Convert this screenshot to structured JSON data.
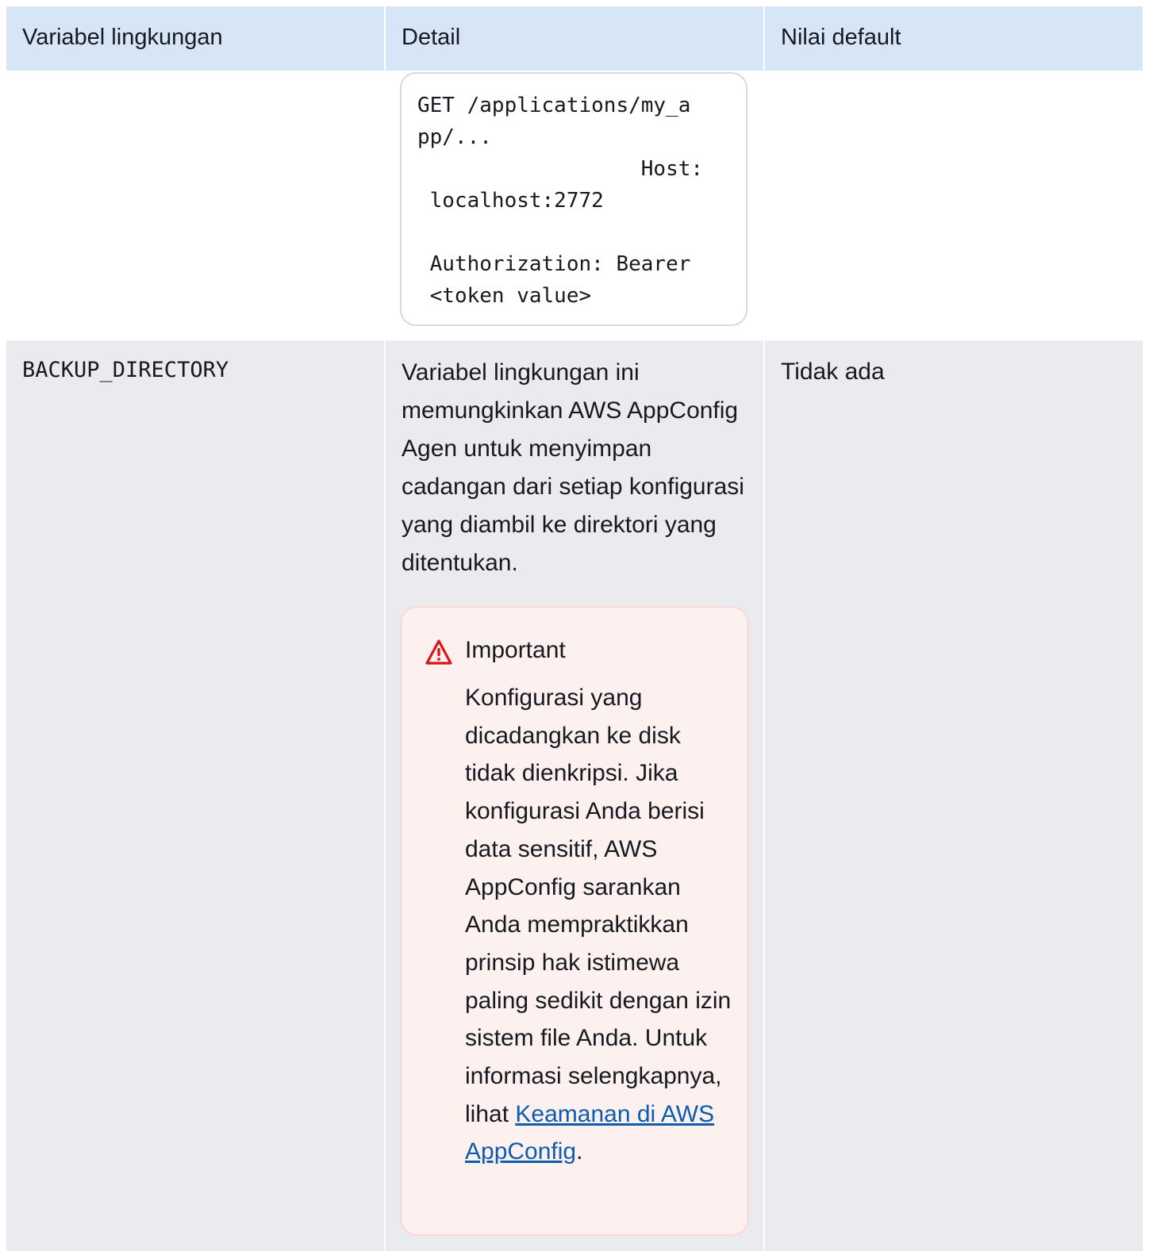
{
  "table": {
    "headers": {
      "variable": "Variabel lingkungan",
      "detail": "Detail",
      "default": "Nilai default"
    },
    "row1": {
      "code": "GET /applications/my_a\npp/...\n                  Host:\n localhost:2772\n\n Authorization: Bearer\n <token value>"
    },
    "row2": {
      "variable": "BACKUP_DIRECTORY",
      "description": "Variabel lingkungan ini memungkinkan AWS AppConfig Agen untuk menyimpan cadangan dari setiap konfigurasi yang diambil ke direktori yang ditentukan.",
      "default": "Tidak ada",
      "important": {
        "title": "Important",
        "body": "Konfigurasi yang dicadangkan ke disk tidak dienkripsi. Jika konfigurasi Anda berisi data sensitif, AWS AppConfig sarankan Anda mempraktikkan prinsip hak istimewa paling sedikit dengan izin sistem file Anda. Untuk informasi selengkapnya, lihat",
        "link_text": "Keamanan di AWS AppConfig",
        "trailing": "."
      }
    }
  },
  "colors": {
    "header_bg": "#d6e6f7",
    "row_alt_bg": "#eaebee",
    "alert_bg": "#fdf1f0",
    "alert_border": "#ffd6d6",
    "warning_icon": "#d91515",
    "link": "#0e5cad"
  },
  "icons": {
    "alert": "warning-triangle-icon"
  }
}
